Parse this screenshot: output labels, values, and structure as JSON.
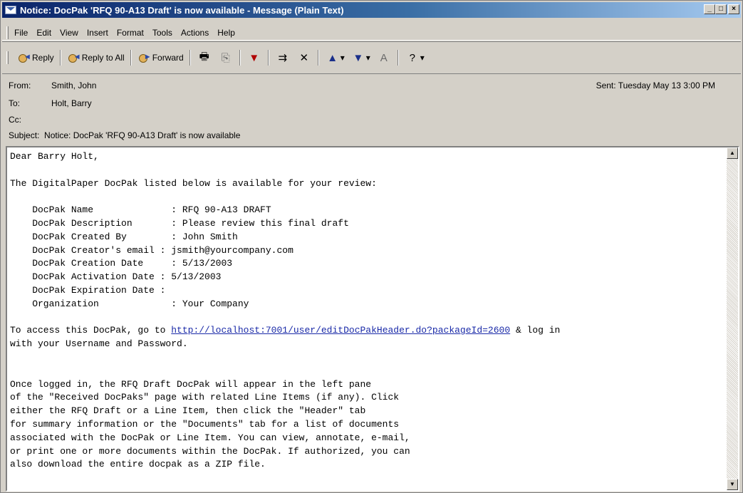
{
  "window": {
    "title": "Notice: DocPak 'RFQ 90-A13 Draft' is now available - Message (Plain Text)",
    "controls": {
      "minimize": "_",
      "maximize": "□",
      "close": "×"
    }
  },
  "menu": {
    "items": [
      "File",
      "Edit",
      "View",
      "Insert",
      "Format",
      "Tools",
      "Actions",
      "Help"
    ]
  },
  "toolbar": {
    "reply": "Reply",
    "reply_all": "Reply to All",
    "forward": "Forward"
  },
  "header": {
    "from_label": "From:",
    "from": "Smith, John",
    "to_label": "To:",
    "to": "Holt, Barry",
    "cc_label": "Cc:",
    "cc": "",
    "subject_label": "Subject:",
    "subject": "Notice: DocPak 'RFQ 90-A13 Draft' is now available",
    "sent": "Sent: Tuesday May 13 3:00 PM"
  },
  "body": {
    "greeting": "Dear Barry Holt,",
    "intro": "The DigitalPaper DocPak listed below is available for your review:",
    "details": [
      "    DocPak Name              : RFQ 90-A13 DRAFT",
      "    DocPak Description       : Please review this final draft",
      "    DocPak Created By        : John Smith",
      "    DocPak Creator's email : jsmith@yourcompany.com",
      "    DocPak Creation Date     : 5/13/2003",
      "    DocPak Activation Date : 5/13/2003",
      "    DocPak Expiration Date :",
      "    Organization             : Your Company"
    ],
    "access_pre": "To access this DocPak, go to ",
    "access_link": "http://localhost:7001/user/editDocPakHeader.do?packageId=2600",
    "access_post": " & log in",
    "access_line2": "with your Username and Password.",
    "paragraph": [
      "Once logged in, the RFQ Draft DocPak will appear in the left pane",
      "of the \"Received DocPaks\" page with related Line Items (if any). Click",
      "either the RFQ Draft or a Line Item, then click the \"Header\" tab",
      "for summary information or the \"Documents\" tab for a list of documents",
      "associated with the DocPak or Line Item. You can view, annotate, e-mail,",
      "or print one or more documents within the DocPak. If authorized, you can",
      "also download the entire docpak as a ZIP file."
    ]
  }
}
